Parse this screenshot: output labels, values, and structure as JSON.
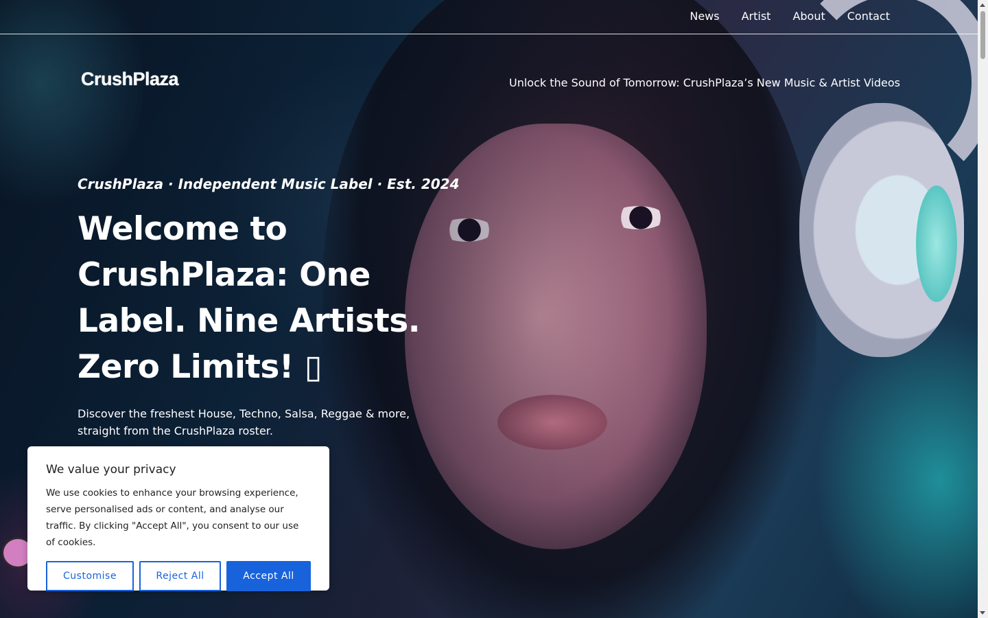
{
  "nav": {
    "items": [
      {
        "label": "News"
      },
      {
        "label": "Artist"
      },
      {
        "label": "About"
      },
      {
        "label": "Contact"
      }
    ]
  },
  "header": {
    "logo_text": "CrushPlaza",
    "tagline": "Unlock the Sound of Tomorrow: CrushPlaza’s New Music & Artist Videos"
  },
  "hero": {
    "eyebrow": "CrushPlaza · Independent Music Label · Est. 2024",
    "headline": "Welcome to CrushPlaza: One Label. Nine Artists. Zero Limits! ▯",
    "subtext": "Discover the freshest House, Techno, Salsa, Reggae & more, straight from the CrushPlaza roster."
  },
  "cookie_banner": {
    "title": "We value your privacy",
    "body": "We use cookies to enhance your browsing experience, serve personalised ads or content, and analyse our traffic. By clicking \"Accept All\", you consent to our use of cookies.",
    "customise_label": "Customise",
    "reject_label": "Reject All",
    "accept_label": "Accept All"
  },
  "colors": {
    "accent": "#1863dc",
    "banner_bg": "#ffffff",
    "text_light": "#ffffff"
  }
}
